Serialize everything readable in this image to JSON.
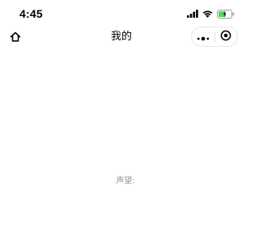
{
  "status_bar": {
    "time": "4:45",
    "icons": [
      "signal-icon",
      "wifi-icon",
      "battery-icon"
    ],
    "battery_color": "#4cd964"
  },
  "nav_bar": {
    "title": "我的",
    "home_icon": "home-icon",
    "menu_icon": "more-dots-icon",
    "close_icon": "target-circle-icon"
  },
  "main": {
    "reputation_label": "声望:",
    "reputation_value": "",
    "label_color": "#8a8f9a"
  }
}
